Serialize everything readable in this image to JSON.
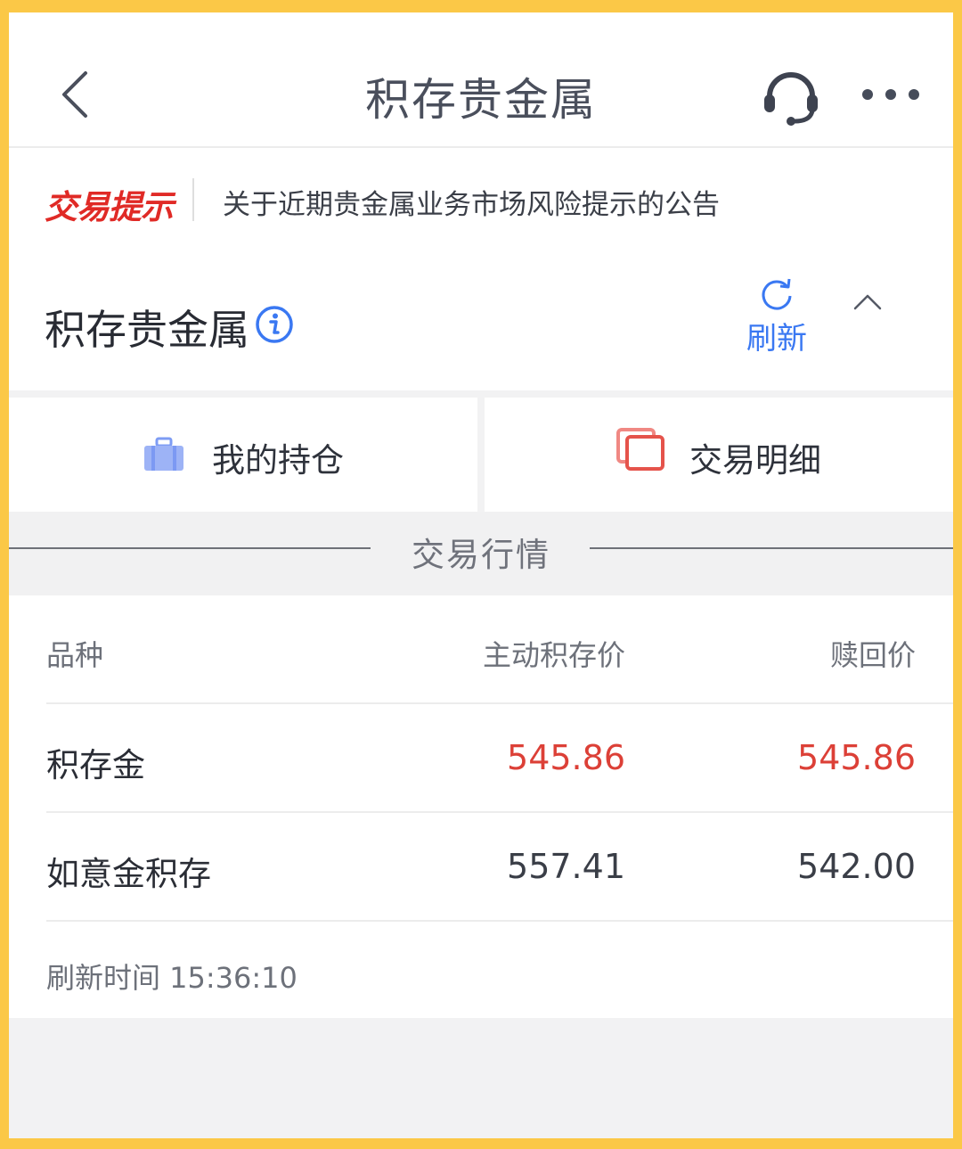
{
  "header": {
    "title": "积存贵金属"
  },
  "notice": {
    "tag": "交易提示",
    "text": "关于近期贵金属业务市场风险提示的公告"
  },
  "section": {
    "title": "积存贵金属",
    "refresh_label": "刷新"
  },
  "tabs": [
    {
      "label": "我的持仓",
      "icon": "briefcase-icon"
    },
    {
      "label": "交易明细",
      "icon": "stacked-cards-icon"
    }
  ],
  "market": {
    "heading": "交易行情",
    "columns": [
      "品种",
      "主动积存价",
      "赎回价"
    ],
    "rows": [
      {
        "name": "积存金",
        "buy": "545.86",
        "redeem": "545.86",
        "highlight": true
      },
      {
        "name": "如意金积存",
        "buy": "557.41",
        "redeem": "542.00",
        "highlight": false
      }
    ],
    "refresh_time": "刷新时间 15:36:10"
  },
  "colors": {
    "accent_blue": "#3a78f2",
    "alert_red": "#e02a26",
    "price_red": "#dc4037",
    "frame_yellow": "#fbc847"
  }
}
